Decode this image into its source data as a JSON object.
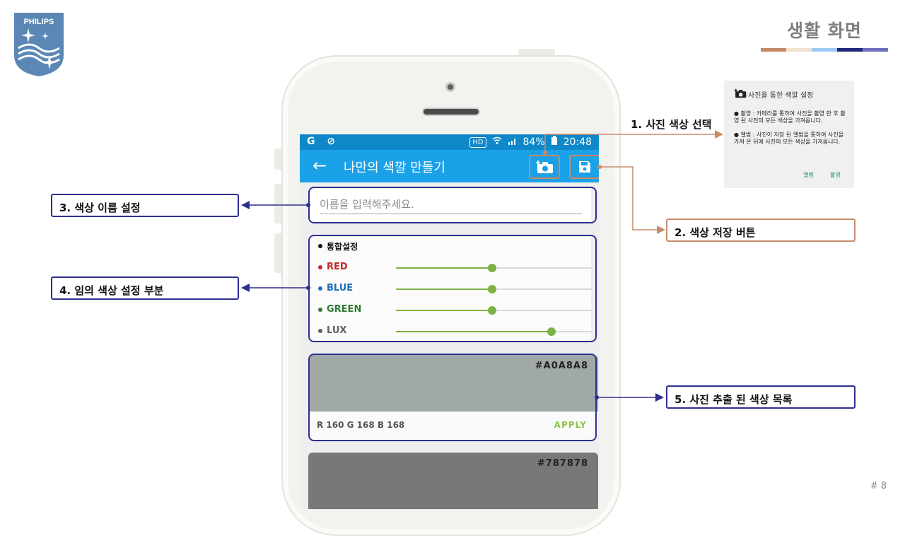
{
  "logo": {
    "text": "PHILIPS"
  },
  "header": {
    "title": "생활 화면",
    "bar_colors": [
      "#c48a66",
      "#f2e1cf",
      "#9ec9f2",
      "#1f2a7a",
      "#6f6fbf"
    ]
  },
  "page_number": "# 8",
  "phone": {
    "status_bar": {
      "left_icons": "G ⊘",
      "hd": "HD",
      "battery": "84%",
      "time": "20:48"
    },
    "app_bar": {
      "back_icon": "back-arrow-icon",
      "title": "나만의 색깔 만들기",
      "camera_icon": "add-photo-camera-icon",
      "save_icon": "save-floppy-icon"
    },
    "name_input": {
      "placeholder": "이름을 입력해주세요.",
      "value": ""
    },
    "sliders": {
      "header": "통합설정",
      "items": [
        {
          "label": "RED",
          "color": "#c62828",
          "level": 0.49
        },
        {
          "label": "BLUE",
          "color": "#1e6fb8",
          "level": 0.49
        },
        {
          "label": "GREEN",
          "color": "#2e7d32",
          "level": 0.49
        },
        {
          "label": "LUX",
          "color": "#616161",
          "level": 0.79
        }
      ]
    },
    "swatches": [
      {
        "hex": "#A0A8A8",
        "color": "#a0a8a8",
        "rgb": "R 160 G 168 B 168",
        "apply": "APPLY"
      },
      {
        "hex": "#787878",
        "color": "#787878",
        "rgb": "",
        "apply": ""
      }
    ]
  },
  "callouts": {
    "c1": "1. 사진 색상 선택",
    "c2": "2. 색상 저장 버튼",
    "c3": "3. 색상 이름 설정",
    "c4": "4. 임의 색상 설정 부분",
    "c5": "5. 사진 추출 된 색상 목록"
  },
  "dialog": {
    "title": "사진을 통한 색깔 설정",
    "camera_icon": "add-photo-camera-icon",
    "text1": "● 촬영 : 카메라를 통하여 사진을 촬영 한 후 촬영 된 사진의 모든 색상을 가져옵니다.",
    "text2": "● 앨범 : 사진이 저장 된 앨범을 통하여 사진을 가져 온 뒤에 사진의 모든 색상을 가져옵니다.",
    "button_album": "앨범",
    "button_capture": "촬영"
  },
  "colors": {
    "highlight": "#2d2f8f",
    "orange": "#c88b6a",
    "app_blue": "#1ba1e8",
    "slider_green": "#7cb342"
  }
}
